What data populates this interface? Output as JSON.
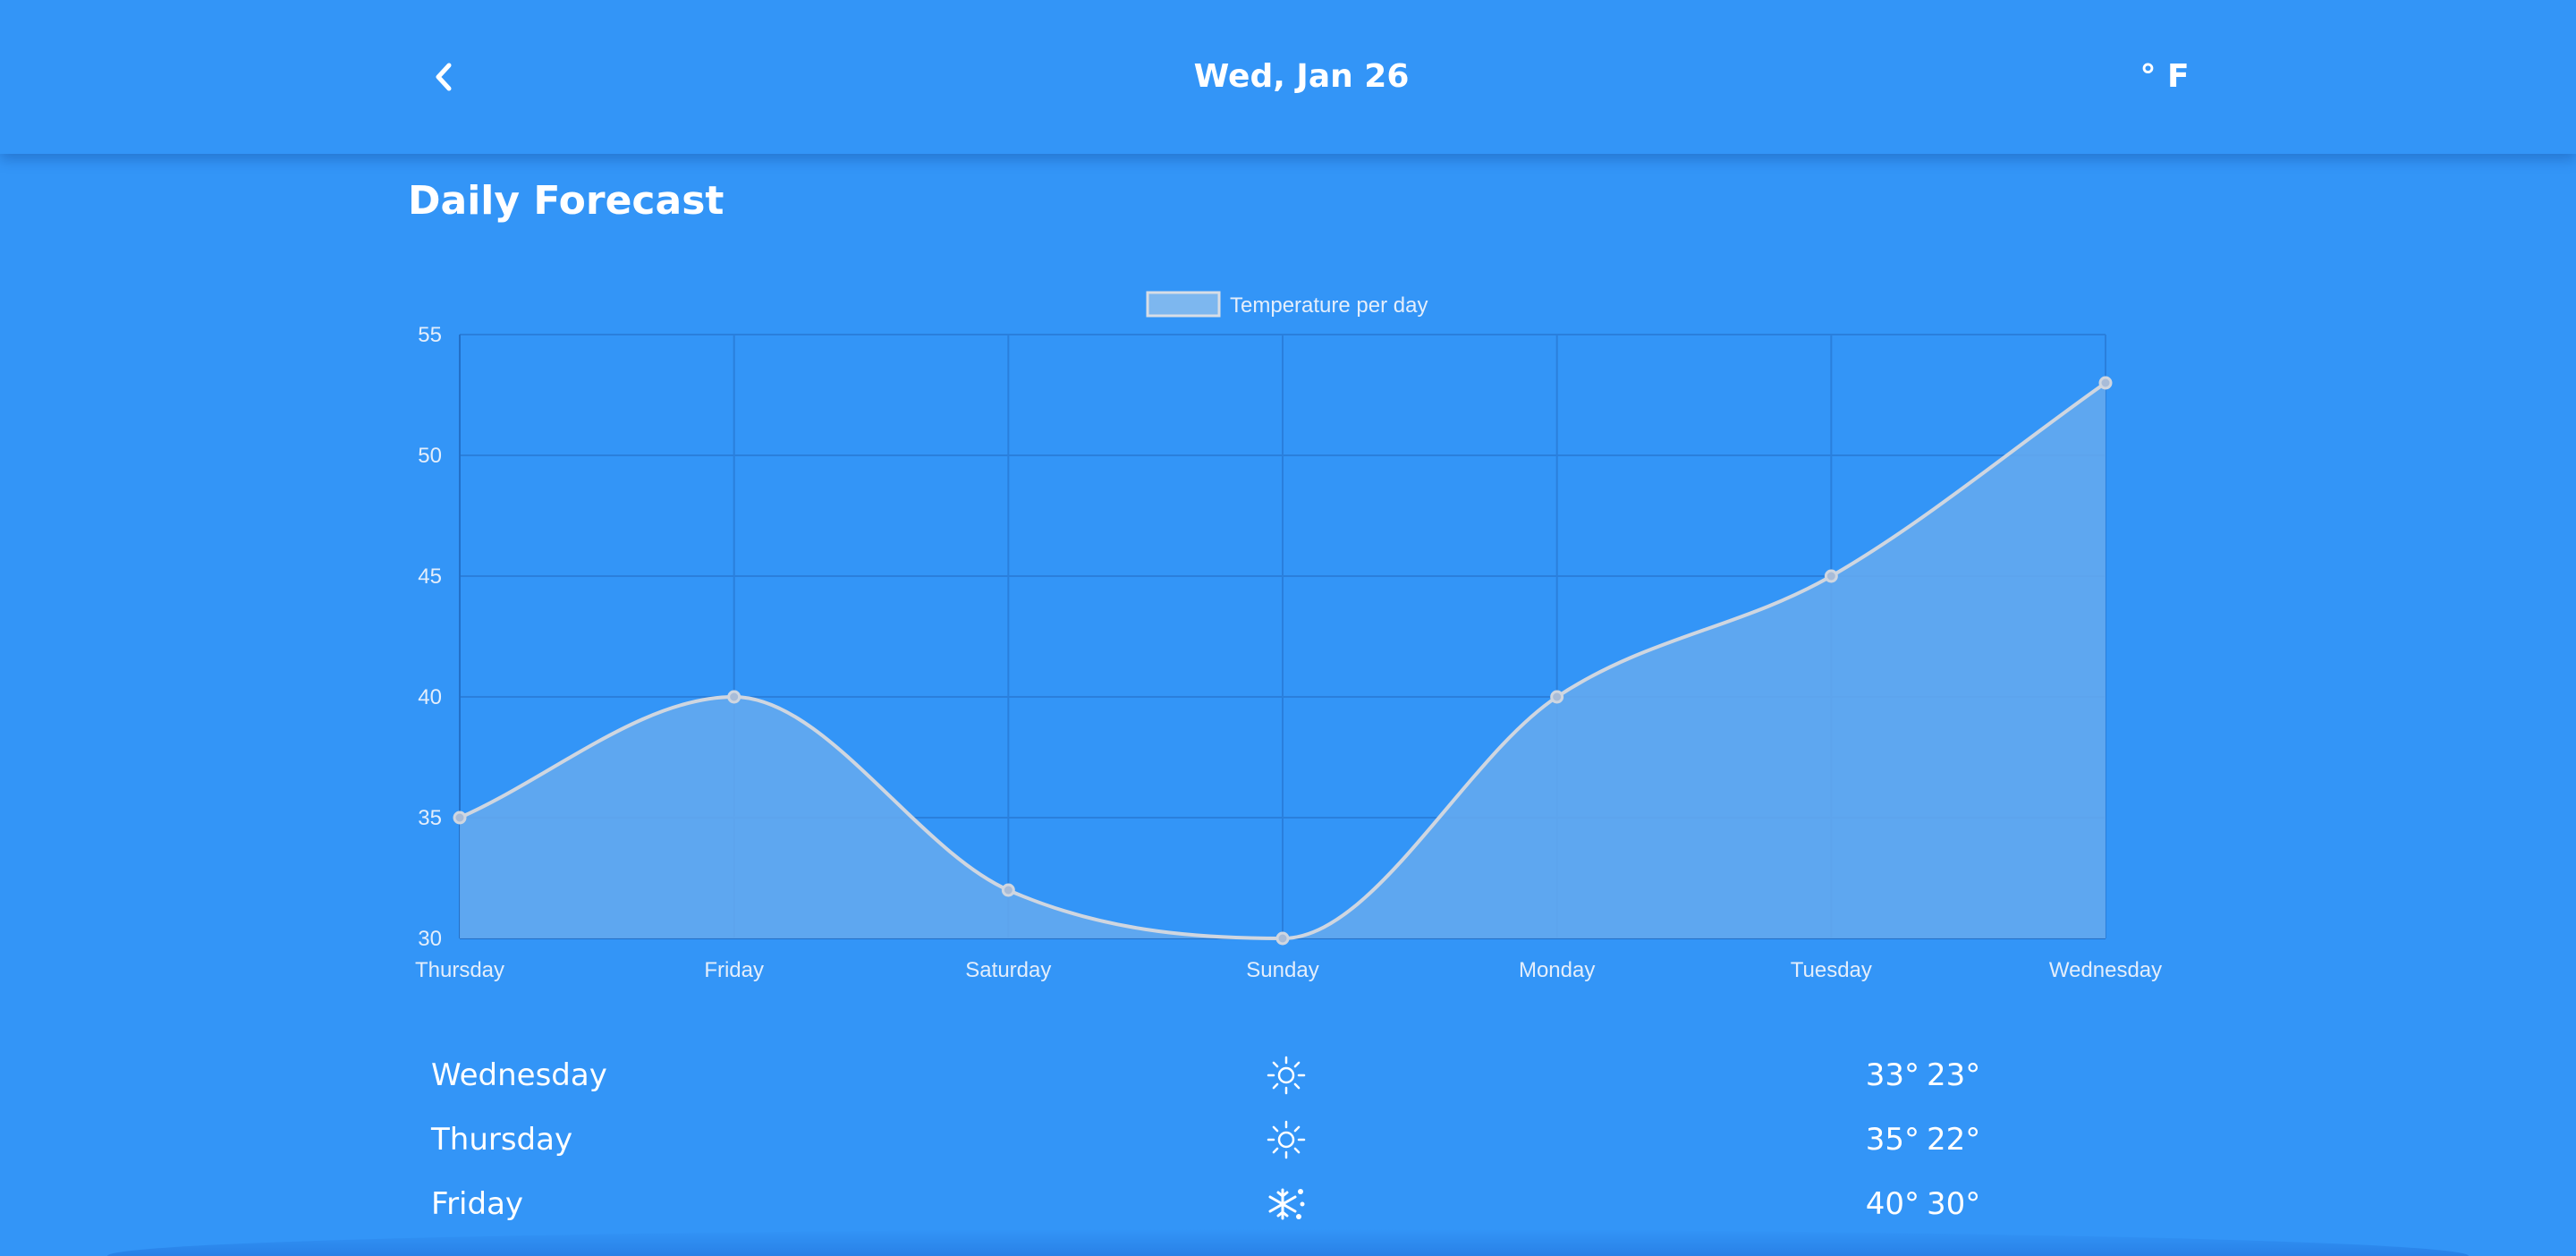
{
  "header": {
    "back_icon": "chevron-left-icon",
    "date": "Wed, Jan 26",
    "unit": "° F"
  },
  "section_title": "Daily Forecast",
  "chart_data": {
    "type": "area",
    "categories": [
      "Thursday",
      "Friday",
      "Saturday",
      "Sunday",
      "Monday",
      "Tuesday",
      "Wednesday"
    ],
    "series": [
      {
        "name": "Temperature per day",
        "values": [
          35,
          40,
          32,
          30,
          40,
          45,
          53
        ]
      }
    ],
    "ylim": [
      30,
      55
    ],
    "yticks": [
      30,
      35,
      40,
      45,
      50,
      55
    ],
    "grid": true,
    "legend": "top-center",
    "colors": {
      "line": "#cfd6e0",
      "fill": "#63a9ee",
      "grid": "#2a7fdc",
      "tick_label": "#e4eefb"
    }
  },
  "forecast": [
    {
      "day": "Wednesday",
      "icon": "sun-icon",
      "high": "33°",
      "low": "23°"
    },
    {
      "day": "Thursday",
      "icon": "sun-icon",
      "high": "35°",
      "low": "22°"
    },
    {
      "day": "Friday",
      "icon": "snowflake-icon",
      "high": "40°",
      "low": "30°"
    }
  ],
  "colors": {
    "background": "#3395f7",
    "text": "#ffffff"
  }
}
